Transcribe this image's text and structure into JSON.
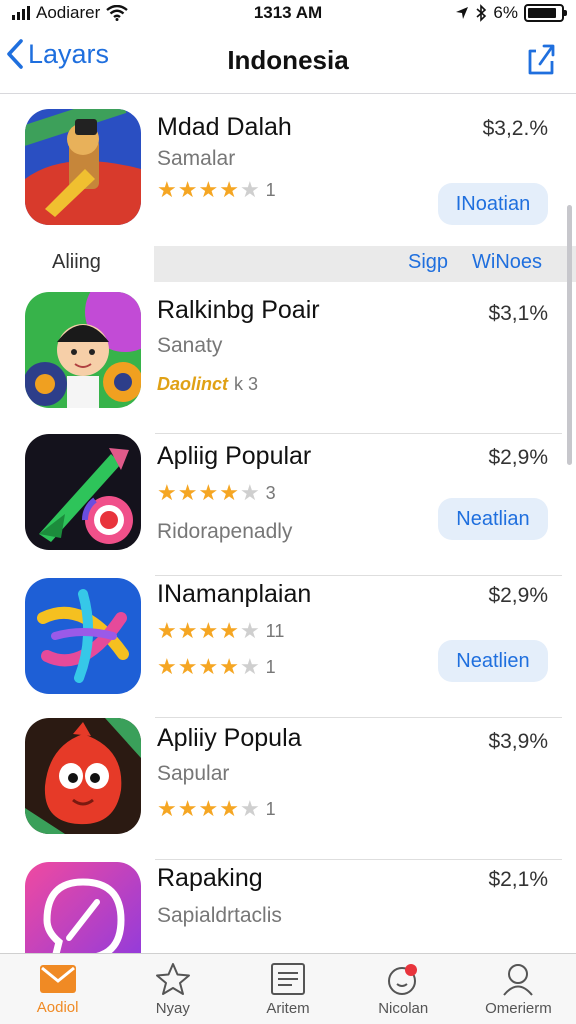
{
  "status_bar": {
    "carrier": "Aodiarer",
    "time": "1313 AM",
    "battery": "6%"
  },
  "nav": {
    "back_label": "Layars",
    "title": "Indonesia"
  },
  "section": {
    "label": "Aliing",
    "link_1": "Sigp",
    "link_2": "WiNoes"
  },
  "apps": [
    {
      "name": "Mdad Dalah",
      "subtitle": "Samalar",
      "price": "$3,2.%",
      "stars": 4,
      "rating_count": "1",
      "button": "INoatian"
    },
    {
      "name": "Ralkinbg Poair",
      "subtitle": "Sanaty",
      "price": "$3,1%",
      "promo": "Daolinct",
      "rating_count": "k 3"
    },
    {
      "name": "Apliig Popular",
      "subtitle": "Ridorapenadly",
      "price": "$2,9%",
      "stars": 4,
      "rating_count": "3",
      "button": "Neatlian"
    },
    {
      "name": "INamanplaian",
      "price": "$2,9%",
      "stars": 4,
      "rating_count": "11",
      "stars_2": 4,
      "rating_count_2": "1",
      "button": "Neatlien"
    },
    {
      "name": "Apliiy Popula",
      "subtitle": "Sapular",
      "price": "$3,9%",
      "stars": 4,
      "rating_count": "1"
    },
    {
      "name": "Rapaking",
      "subtitle": "Sapialdrtaclis",
      "price": "$2,1%"
    }
  ],
  "tabs": [
    {
      "label": "Aodiol",
      "icon": "mail-icon",
      "active": true
    },
    {
      "label": "Nyay",
      "icon": "star-icon"
    },
    {
      "label": "Aritem",
      "icon": "list-icon"
    },
    {
      "label": "Nicolan",
      "icon": "notification-icon"
    },
    {
      "label": "Omerierm",
      "icon": "person-icon"
    }
  ],
  "colors": {
    "accent": "#1f6fde",
    "star": "#f5a623",
    "active_tab": "#f08a24"
  }
}
